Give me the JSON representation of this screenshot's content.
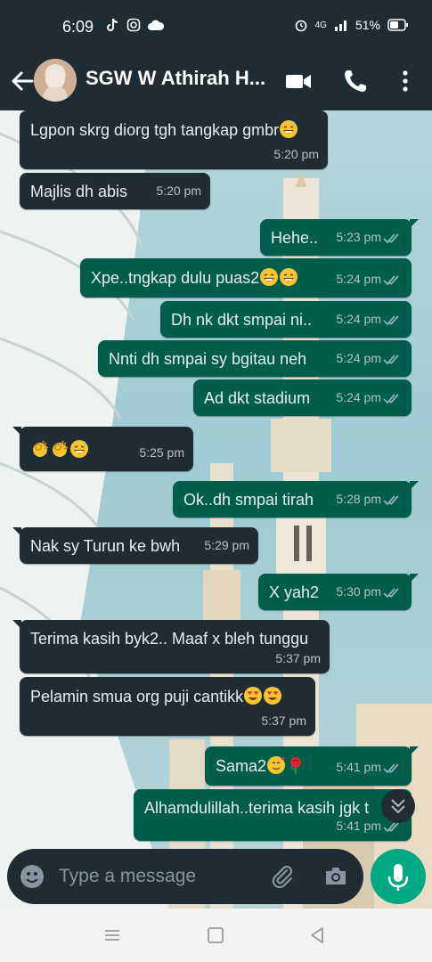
{
  "status_bar": {
    "time": "6:09",
    "network": "4G",
    "battery": "51%"
  },
  "header": {
    "contact_name": "SGW W Athirah H..."
  },
  "messages": [
    {
      "dir": "in",
      "text": "Lgpon skrg diorg tgh tangkap gmbr",
      "emoji": [
        "sweat-smile"
      ],
      "time": "5:20 pm"
    },
    {
      "dir": "in",
      "text": "Majlis dh abis",
      "emoji": [],
      "time": "5:20 pm"
    },
    {
      "dir": "out",
      "text": "Hehe..",
      "emoji": [],
      "time": "5:23 pm"
    },
    {
      "dir": "out",
      "text": "Xpe..tngkap dulu puas2",
      "emoji": [
        "grin",
        "grin"
      ],
      "time": "5:24 pm"
    },
    {
      "dir": "out",
      "text": "Dh nk dkt smpai ni..",
      "emoji": [],
      "time": "5:24 pm"
    },
    {
      "dir": "out",
      "text": "Nnti dh smpai sy bgitau neh",
      "emoji": [],
      "time": "5:24 pm"
    },
    {
      "dir": "out",
      "text": "Ad dkt stadium",
      "emoji": [],
      "time": "5:24 pm"
    },
    {
      "dir": "in",
      "text": "",
      "emoji": [
        "ok-hand",
        "ok-hand",
        "sweat-smile"
      ],
      "time": "5:25 pm"
    },
    {
      "dir": "out",
      "text": "Ok..dh smpai tirah",
      "emoji": [],
      "time": "5:28 pm"
    },
    {
      "dir": "in",
      "text": "Nak sy Turun ke bwh",
      "emoji": [],
      "time": "5:29 pm"
    },
    {
      "dir": "out",
      "text": "X yah2",
      "emoji": [],
      "time": "5:30 pm"
    },
    {
      "dir": "in",
      "text": "Terima kasih byk2.. Maaf x bleh tunggu",
      "emoji": [],
      "time": "5:37 pm"
    },
    {
      "dir": "in",
      "text": "Pelamin smua org puji cantikk",
      "emoji": [
        "heart-eyes",
        "heart-eyes"
      ],
      "time": "5:37 pm"
    },
    {
      "dir": "out",
      "text": "Sama2",
      "emoji": [
        "smiling-hearts",
        "rose"
      ],
      "time": "5:41 pm"
    },
    {
      "dir": "out",
      "text": "Alhamdulillah..terima kasih jgk t",
      "emoji": [],
      "time": "5:41 pm"
    }
  ],
  "composer": {
    "placeholder": "Type a message"
  },
  "colors": {
    "header": "#1f2c34",
    "incoming_bubble": "#1f2c34",
    "outgoing_bubble": "#005c4b",
    "accent": "#00a884",
    "ticks": "#8fb3bd"
  }
}
